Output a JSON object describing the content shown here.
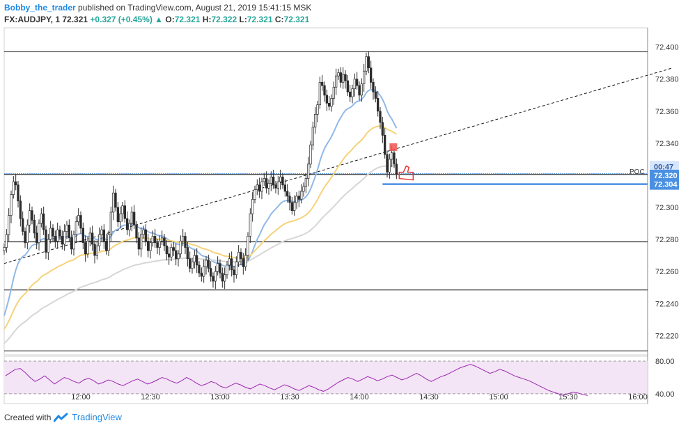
{
  "header": {
    "author": "Bobby_the_trader",
    "published": "published on TradingView.com, August 21, 2019 15:41:15 MSK",
    "symbol": "FX:AUDJPY, 1",
    "last": "72.321",
    "change": "+0.327 (+0.45%)",
    "o_label": "O:",
    "o": "72.321",
    "h_label": "H:",
    "h": "72.322",
    "l_label": "L:",
    "l": "72.321",
    "c_label": "C:",
    "c": "72.321"
  },
  "footer": {
    "created_with": "Created with",
    "brand": "TradingView"
  },
  "colors": {
    "bull": "#26a69a",
    "bear": "#ef5350",
    "candle": "#2b2b2b",
    "ma_fast": "#90b8e8",
    "ma_mid": "#f5d27a",
    "ma_slow": "#d6d6d6",
    "price_line": "#4a90e2",
    "rsi": "#9c27b0",
    "rsi_band": "#f3e5f5"
  },
  "chart_data": {
    "type": "candlestick",
    "symbol": "AUDJPY",
    "interval": "1",
    "x_tick_labels": [
      "12:00",
      "12:30",
      "13:00",
      "13:30",
      "14:00",
      "14:30",
      "15:00",
      "15:30",
      "16:00"
    ],
    "y_tick_labels": [
      "72.400",
      "72.380",
      "72.360",
      "72.340",
      "72.300",
      "72.280",
      "72.260",
      "72.240",
      "72.220"
    ],
    "ylim": [
      72.208,
      72.412
    ],
    "price_labels": [
      {
        "text": "72.321",
        "value": 72.321,
        "kind": "last"
      },
      {
        "text": "00:47",
        "value": 72.3255,
        "kind": "timer"
      },
      {
        "text": "72.320",
        "value": 72.32,
        "kind": "level"
      },
      {
        "text": "72.304",
        "value": 72.3145,
        "kind": "level"
      }
    ],
    "poc_label": "POC",
    "horizontal_levels": [
      72.397,
      72.3205,
      72.2785,
      72.2485,
      72.2105
    ],
    "trendline": {
      "start": [
        "11:27",
        72.265
      ],
      "end": [
        "16:15",
        72.387
      ]
    },
    "close_series_1min": [
      72.275,
      72.283,
      72.295,
      72.308,
      72.316,
      72.314,
      72.304,
      72.293,
      72.285,
      72.278,
      72.289,
      72.298,
      72.292,
      72.284,
      72.278,
      72.29,
      72.296,
      72.286,
      72.272,
      72.28,
      72.287,
      72.282,
      72.279,
      72.286,
      72.282,
      72.277,
      72.285,
      72.289,
      72.281,
      72.274,
      72.283,
      72.291,
      72.295,
      72.287,
      72.278,
      72.271,
      72.279,
      72.284,
      72.277,
      72.27,
      72.276,
      72.283,
      72.286,
      72.279,
      72.273,
      72.283,
      72.297,
      72.309,
      72.3,
      72.291,
      72.296,
      72.301,
      72.293,
      72.286,
      72.29,
      72.297,
      72.289,
      72.281,
      72.274,
      72.283,
      72.286,
      72.279,
      72.273,
      72.278,
      72.282,
      72.278,
      72.275,
      72.279,
      72.281,
      72.276,
      72.271,
      72.269,
      72.275,
      72.273,
      72.268,
      72.271,
      72.279,
      72.282,
      72.275,
      72.268,
      72.262,
      72.266,
      72.27,
      72.264,
      72.259,
      72.257,
      72.263,
      72.267,
      72.262,
      72.257,
      72.254,
      72.26,
      72.265,
      72.259,
      72.254,
      72.258,
      72.264,
      72.268,
      72.261,
      72.258,
      72.266,
      72.272,
      72.268,
      72.263,
      72.27,
      72.282,
      72.296,
      72.305,
      72.311,
      72.314,
      72.31,
      72.316,
      72.318,
      72.312,
      72.315,
      72.319,
      72.314,
      72.312,
      72.316,
      72.319,
      72.314,
      72.31,
      72.307,
      72.303,
      72.298,
      72.303,
      72.307,
      72.305,
      72.31,
      72.313,
      72.318,
      72.327,
      72.339,
      72.35,
      72.358,
      72.364,
      72.378,
      72.376,
      72.37,
      72.365,
      72.363,
      72.368,
      72.375,
      72.382,
      72.384,
      72.378,
      72.383,
      72.379,
      72.372,
      72.369,
      72.374,
      72.38,
      72.376,
      72.37,
      72.377,
      72.385,
      72.394,
      72.387,
      72.378,
      72.372,
      72.368,
      72.36,
      72.353,
      72.345,
      72.333,
      72.322,
      72.33,
      72.334,
      72.327,
      72.321
    ],
    "rsi": {
      "levels": [
        80.0,
        40.0
      ],
      "y_tick_labels": [
        "80.00",
        "40.00"
      ],
      "ylim": [
        28,
        86
      ],
      "values": [
        62,
        66,
        70,
        71,
        66,
        60,
        55,
        58,
        62,
        57,
        52,
        56,
        60,
        58,
        55,
        53,
        57,
        59,
        56,
        52,
        54,
        57,
        55,
        52,
        50,
        53,
        56,
        58,
        55,
        52,
        54,
        57,
        60,
        58,
        55,
        53,
        56,
        60,
        57,
        53,
        50,
        52,
        55,
        53,
        49,
        47,
        50,
        53,
        51,
        48,
        46,
        49,
        52,
        50,
        47,
        45,
        48,
        51,
        49,
        46,
        44,
        47,
        50,
        48,
        45,
        43,
        46,
        50,
        54,
        57,
        60,
        58,
        55,
        58,
        61,
        59,
        56,
        58,
        61,
        63,
        60,
        57,
        59,
        62,
        65,
        62,
        58,
        55,
        58,
        61,
        63,
        66,
        69,
        72,
        74,
        76,
        74,
        71,
        68,
        65,
        67,
        70,
        68,
        65,
        62,
        60,
        58,
        56,
        53,
        50,
        47,
        44,
        42,
        40,
        38,
        40,
        42,
        41,
        39,
        38
      ]
    }
  }
}
